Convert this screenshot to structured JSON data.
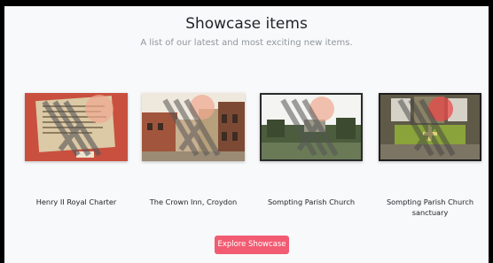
{
  "header": {
    "title": "Showcase items",
    "subtitle": "A list of our latest and most exciting new items."
  },
  "items": [
    {
      "caption": "Henry II Royal Charter",
      "thumb_icon": "charter-document-image"
    },
    {
      "caption": "The Crown Inn, Croydon",
      "thumb_icon": "street-buildings-image"
    },
    {
      "caption": "Sompting Parish Church",
      "thumb_icon": "church-landscape-image"
    },
    {
      "caption": "Sompting Parish Church sanctuary",
      "thumb_icon": "church-interior-image"
    }
  ],
  "cta": {
    "label": "Explore Showcase"
  },
  "colors": {
    "accent": "#f25c73",
    "watermark_circle": "#f0a890",
    "watermark_stripes": "#555555"
  }
}
